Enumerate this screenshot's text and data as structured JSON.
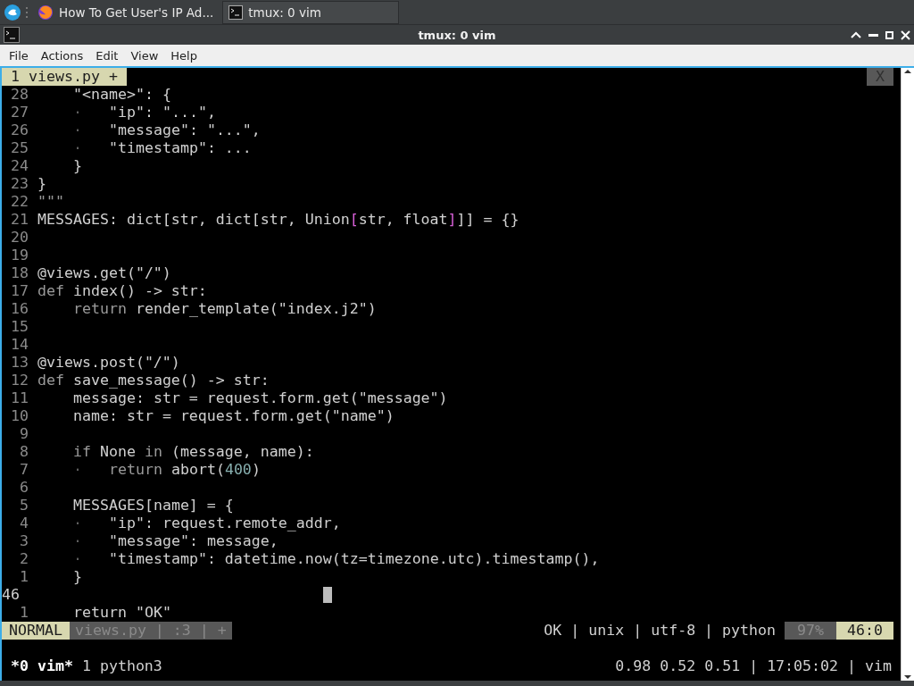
{
  "taskbar": {
    "tasks": [
      {
        "label": "How To Get User's IP Ad...",
        "selected": false
      },
      {
        "label": "tmux: 0 vim",
        "selected": true
      }
    ]
  },
  "window": {
    "title": "tmux: 0 vim"
  },
  "menu": [
    "File",
    "Actions",
    "Edit",
    "View",
    "Help"
  ],
  "vim": {
    "tabs": [
      {
        "label": "1 views.py +",
        "selected": true
      }
    ],
    "close_label": "X",
    "lines": [
      {
        "number": "28",
        "indent": true,
        "segments": [
          {
            "kind": "text",
            "text": "\"<name>\": {"
          }
        ]
      },
      {
        "number": "27",
        "indent": true,
        "segments": [
          {
            "kind": "guide",
            "text": "·"
          },
          {
            "kind": "text",
            "text": "\"ip\": \"...\","
          }
        ]
      },
      {
        "number": "26",
        "indent": true,
        "segments": [
          {
            "kind": "guide",
            "text": "·"
          },
          {
            "kind": "text",
            "text": "\"message\": \"...\","
          }
        ]
      },
      {
        "number": "25",
        "indent": true,
        "segments": [
          {
            "kind": "guide",
            "text": "·"
          },
          {
            "kind": "text",
            "text": "\"timestamp\": ..."
          }
        ]
      },
      {
        "number": "24",
        "indent": true,
        "segments": [
          {
            "kind": "text",
            "text": "}"
          }
        ]
      },
      {
        "number": "23",
        "segments": [
          {
            "kind": "text",
            "text": "}"
          }
        ]
      },
      {
        "number": "22",
        "segments": [
          {
            "kind": "dim",
            "text": "\"\"\""
          }
        ]
      },
      {
        "number": "21",
        "segments": [
          {
            "kind": "text",
            "text": "MESSAGES: dict[str, dict[str, Union"
          },
          {
            "kind": "bracket",
            "text": "["
          },
          {
            "kind": "text",
            "text": "str, float"
          },
          {
            "kind": "bracket",
            "text": "]"
          },
          {
            "kind": "text",
            "text": "]] = {}"
          }
        ]
      },
      {
        "number": "20"
      },
      {
        "number": "19"
      },
      {
        "number": "18",
        "segments": [
          {
            "kind": "text",
            "text": "@views.get(\"/\")"
          }
        ]
      },
      {
        "number": "17",
        "segments": [
          {
            "kind": "dim",
            "text": "def"
          },
          {
            "kind": "text",
            "text": " index() -> str:"
          }
        ]
      },
      {
        "number": "16",
        "indent": true,
        "segments": [
          {
            "kind": "dim",
            "text": "return"
          },
          {
            "kind": "text",
            "text": " render_template(\"index.j2\")"
          }
        ]
      },
      {
        "number": "15"
      },
      {
        "number": "14"
      },
      {
        "number": "13",
        "segments": [
          {
            "kind": "text",
            "text": "@views.post(\"/\")"
          }
        ]
      },
      {
        "number": "12",
        "segments": [
          {
            "kind": "dim",
            "text": "def"
          },
          {
            "kind": "text",
            "text": " save_message() -> str:"
          }
        ]
      },
      {
        "number": "11",
        "indent": true,
        "segments": [
          {
            "kind": "text",
            "text": "message: str = request.form.get(\"message\")"
          }
        ]
      },
      {
        "number": "10",
        "indent": true,
        "segments": [
          {
            "kind": "text",
            "text": "name: str = request.form.get(\"name\")"
          }
        ]
      },
      {
        "number": "9"
      },
      {
        "number": "8",
        "indent": true,
        "segments": [
          {
            "kind": "dim",
            "text": "if"
          },
          {
            "kind": "text",
            "text": " None "
          },
          {
            "kind": "dim",
            "text": "in"
          },
          {
            "kind": "text",
            "text": " (message, name):"
          }
        ]
      },
      {
        "number": "7",
        "indent": true,
        "segments": [
          {
            "kind": "guide",
            "text": "·"
          },
          {
            "kind": "dim",
            "text": "return"
          },
          {
            "kind": "text",
            "text": " abort("
          },
          {
            "kind": "number",
            "text": "400"
          },
          {
            "kind": "text",
            "text": ")"
          }
        ]
      },
      {
        "number": "6"
      },
      {
        "number": "5",
        "indent": true,
        "segments": [
          {
            "kind": "text",
            "text": "MESSAGES[name] = {"
          }
        ]
      },
      {
        "number": "4",
        "indent": true,
        "segments": [
          {
            "kind": "guide",
            "text": "·"
          },
          {
            "kind": "text",
            "text": "\"ip\": request.remote_addr,"
          }
        ]
      },
      {
        "number": "3",
        "indent": true,
        "segments": [
          {
            "kind": "guide",
            "text": "·"
          },
          {
            "kind": "text",
            "text": "\"message\": message,"
          }
        ]
      },
      {
        "number": "2",
        "indent": true,
        "segments": [
          {
            "kind": "guide",
            "text": "·"
          },
          {
            "kind": "text",
            "text": "\"timestamp\": datetime.now(tz=timezone.utc).timestamp(),"
          }
        ]
      },
      {
        "number": "1",
        "indent": true,
        "segments": [
          {
            "kind": "text",
            "text": "}"
          }
        ]
      },
      {
        "number": "46",
        "current": true
      },
      {
        "number": "1",
        "indent": true,
        "segments": [
          {
            "kind": "text",
            "text": "return \"OK\""
          }
        ]
      }
    ],
    "statusline": {
      "mode": "NORMAL",
      "file": "views.py | :3 | +",
      "info": "OK | unix | utf-8 | python",
      "percent": "97%",
      "position": "46:0"
    }
  },
  "tmux": {
    "windows": [
      {
        "label": "*0 vim*",
        "selected": true
      },
      {
        "label": "1 python3",
        "selected": false
      }
    ],
    "status": "0.98 0.52 0.51 | 17:05:02 | vim"
  }
}
